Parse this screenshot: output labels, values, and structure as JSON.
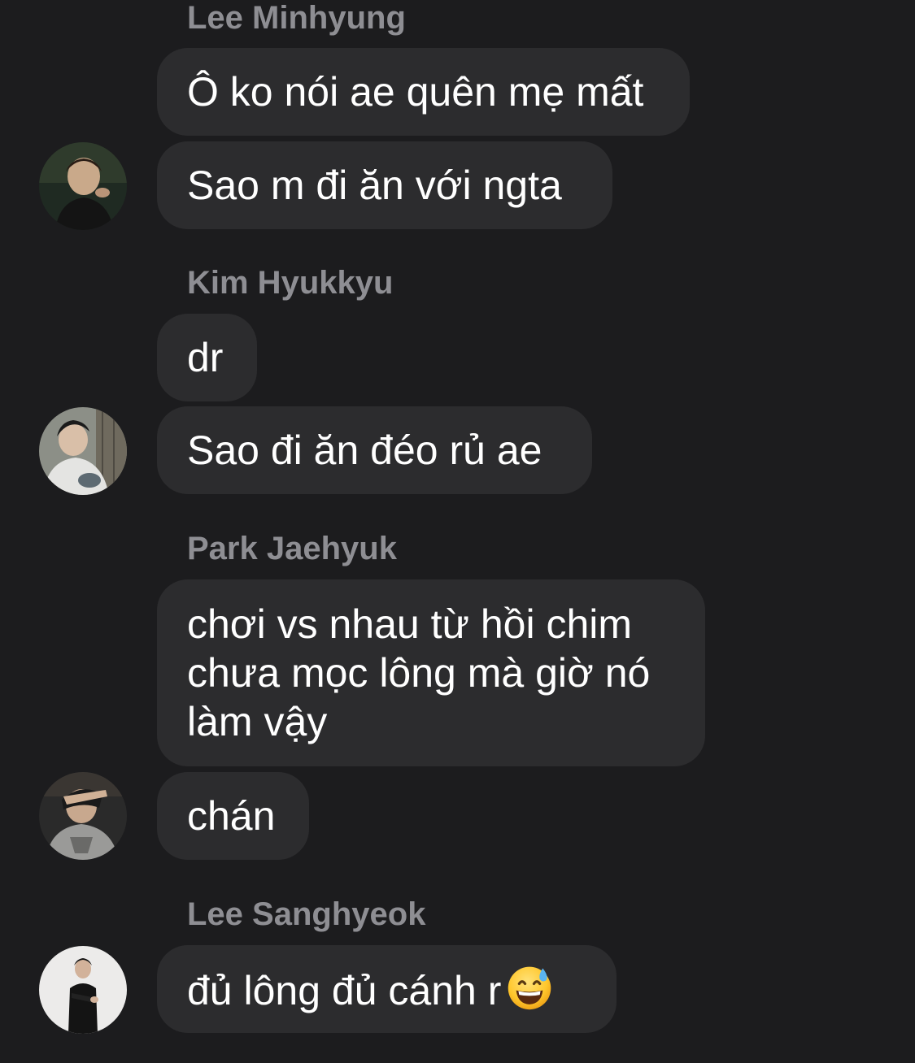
{
  "conversation": {
    "groups": [
      {
        "sender": "Lee Minhyung",
        "messages": [
          "Ô ko nói ae quên mẹ mất",
          "Sao m đi ăn với ngta"
        ],
        "avatar": "profile-photo-person-in-dark-jacket"
      },
      {
        "sender": "Kim Hyukkyu",
        "messages": [
          "dr",
          "Sao đi ăn đéo rủ ae"
        ],
        "avatar": "profile-photo-person-in-white-shirt"
      },
      {
        "sender": "Park Jaehyuk",
        "messages": [
          "chơi vs nhau từ hồi chim\nchưa mọc lông mà giờ nó\nlàm vậy",
          "chán"
        ],
        "avatar": "profile-photo-person-covering-face"
      },
      {
        "sender": "Lee Sanghyeok",
        "messages": [
          "đủ lông đủ cánh r"
        ],
        "emoji": "grinning-face-with-sweat",
        "avatar": "profile-photo-person-in-black-suit"
      }
    ]
  },
  "colors": {
    "background": "#1c1c1e",
    "bubble": "#2c2c2e",
    "sender_name": "#8e8e93",
    "message_text": "#ffffff"
  }
}
